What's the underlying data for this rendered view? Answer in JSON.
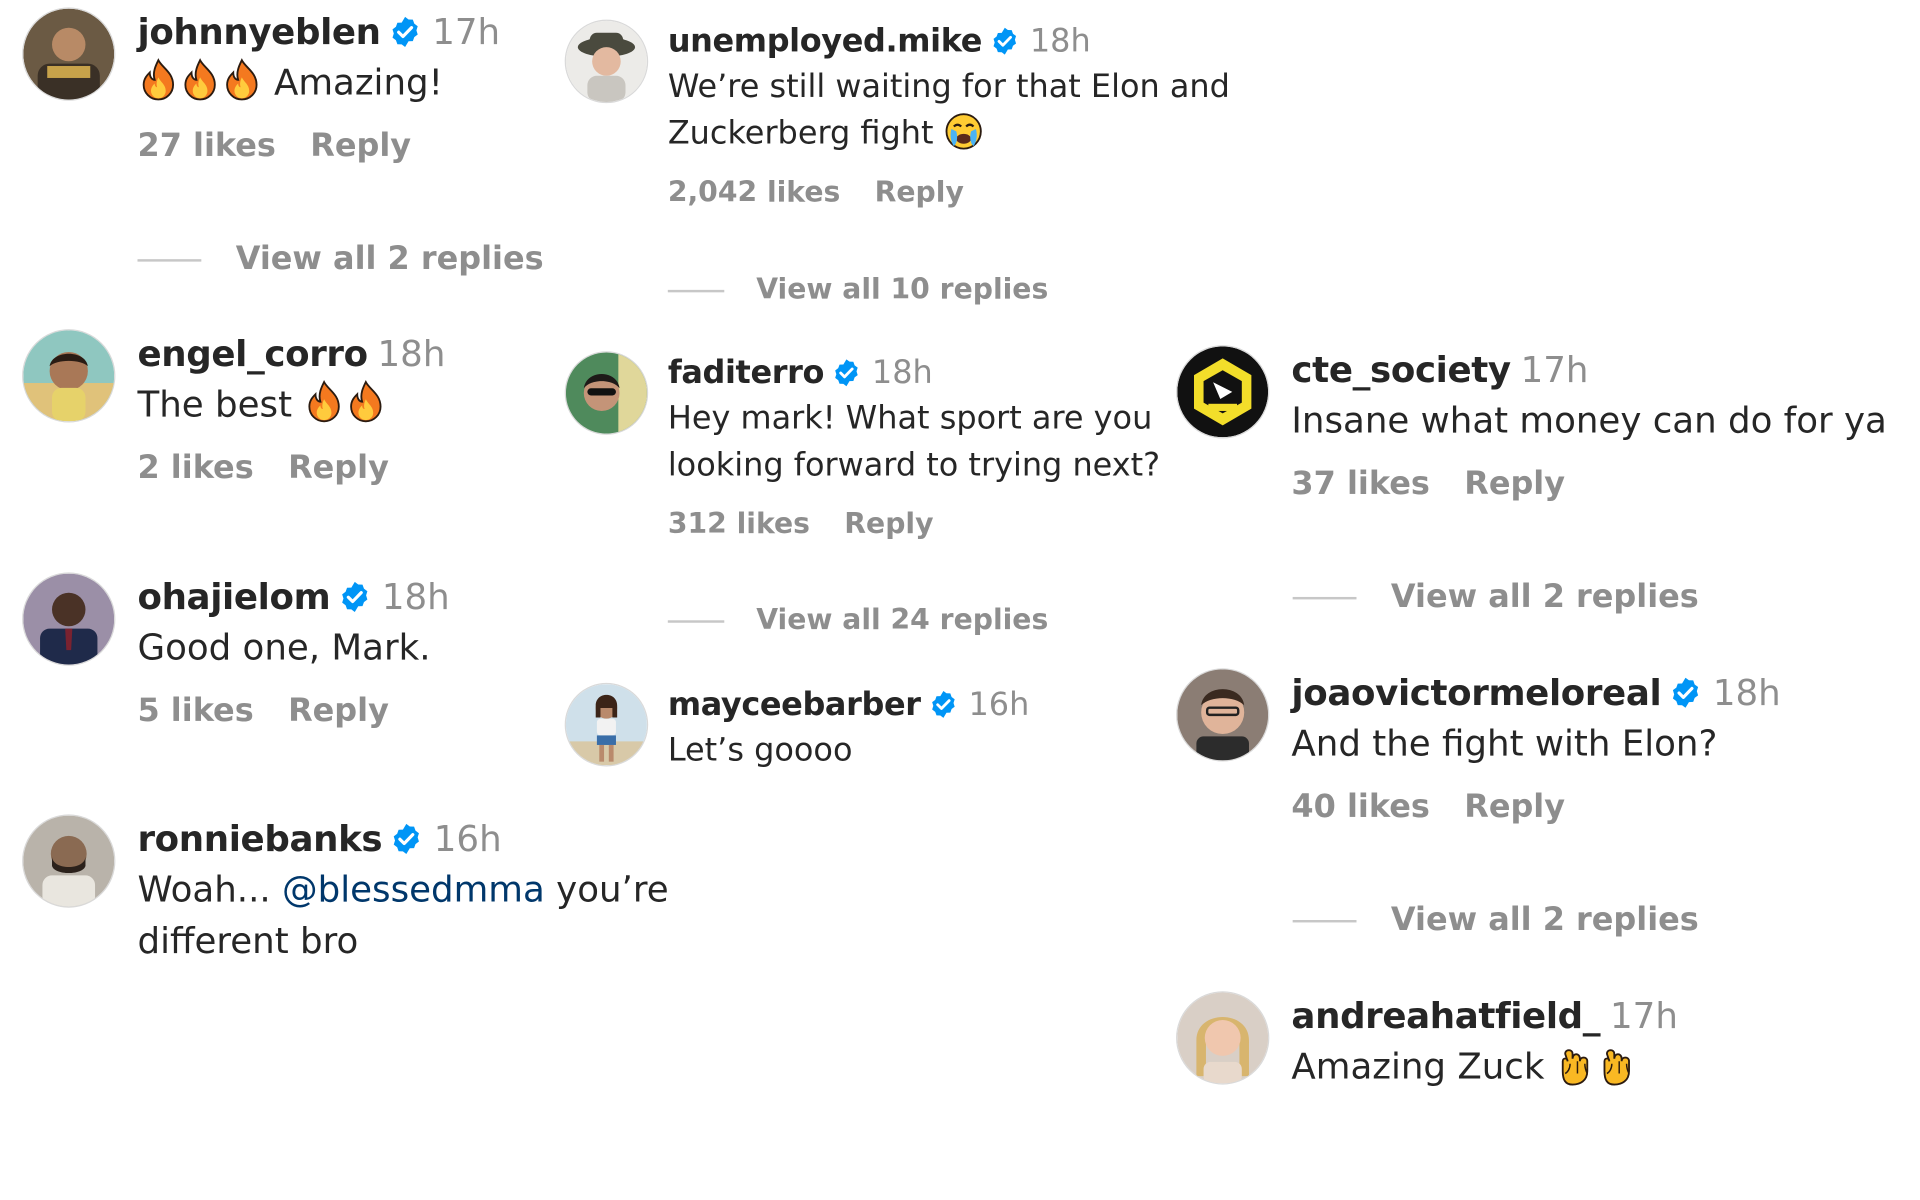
{
  "colors": {
    "username": "#262626",
    "meta": "#8e8e8e",
    "verified_badge": "#0095f6",
    "mention": "#00376b"
  },
  "comments": [
    {
      "id": "c0",
      "username": "johnnyeblen",
      "verified": true,
      "time": "17h",
      "text": "Amazing!",
      "emoji_prefix": [
        "fire-emoji",
        "fire-emoji",
        "fire-emoji"
      ],
      "likes": "27 likes",
      "reply": "Reply",
      "view_replies": "View all 2 replies"
    },
    {
      "id": "c1",
      "username": "engel_corro",
      "verified": false,
      "time": "18h",
      "text": "The best",
      "emoji_suffix": [
        "fire-emoji",
        "fire-emoji"
      ],
      "likes": "2 likes",
      "reply": "Reply"
    },
    {
      "id": "c2",
      "username": "ohajielom",
      "verified": true,
      "time": "18h",
      "text": "Good one, Mark.",
      "likes": "5 likes",
      "reply": "Reply"
    },
    {
      "id": "c3",
      "username": "ronniebanks",
      "verified": true,
      "time": "16h",
      "text_before": "Woah... ",
      "mention": "@blessedmma",
      "text_after": " you’re",
      "text_line2": "different bro"
    },
    {
      "id": "c4",
      "username": "unemployed.mike",
      "verified": true,
      "time": "18h",
      "text_line1": "We’re still waiting for that Elon and",
      "text_line2": "Zuckerberg fight",
      "emoji_suffix": [
        "crying-face-emoji"
      ],
      "likes": "2,042 likes",
      "reply": "Reply",
      "view_replies": "View all 10 replies"
    },
    {
      "id": "c5",
      "username": "faditerro",
      "verified": true,
      "time": "18h",
      "text_line1": "Hey mark! What sport are you",
      "text_line2": "looking forward to trying next?",
      "likes": "312 likes",
      "reply": "Reply",
      "view_replies": "View all 24 replies"
    },
    {
      "id": "c6",
      "username": "mayceebarber",
      "verified": true,
      "time": "16h",
      "text": "Let’s goooo"
    },
    {
      "id": "c7",
      "username": "cte_society",
      "verified": false,
      "time": "17h",
      "text": "Insane what money can do for ya",
      "likes": "37 likes",
      "reply": "Reply",
      "view_replies": "View all 2 replies"
    },
    {
      "id": "c8",
      "username": "joaovictormeloreal",
      "verified": true,
      "time": "18h",
      "text": "And the fight with Elon?",
      "likes": "40 likes",
      "reply": "Reply",
      "view_replies": "View all 2 replies"
    },
    {
      "id": "c9",
      "username": "andreahatfield_",
      "verified": false,
      "time": "17h",
      "text": "Amazing Zuck",
      "emoji_suffix": [
        "clapping-hands-emoji",
        "clapping-hands-emoji"
      ]
    }
  ]
}
